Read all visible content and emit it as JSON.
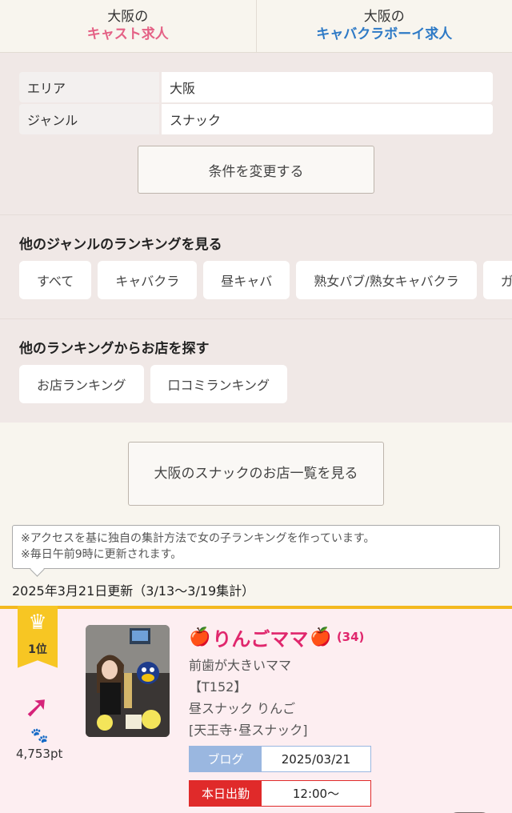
{
  "recruit_tabs": [
    {
      "sub": "大阪の",
      "main": "キャスト求人",
      "color": "#e46185"
    },
    {
      "sub": "大阪の",
      "main": "キャバクラボーイ求人",
      "color": "#2e7ac6"
    }
  ],
  "conditions": {
    "rows": [
      {
        "label": "エリア",
        "value": "大阪"
      },
      {
        "label": "ジャンル",
        "value": "スナック"
      }
    ],
    "change_button": "条件を変更する"
  },
  "genre_ranking": {
    "title": "他のジャンルのランキングを見る",
    "chips": [
      "すべて",
      "キャバクラ",
      "昼キャバ",
      "熟女パブ/熟女キャバクラ",
      "ガ"
    ]
  },
  "other_ranking": {
    "title": "他のランキングからお店を探す",
    "chips": [
      "お店ランキング",
      "口コミランキング"
    ]
  },
  "shop_list_button": "大阪のスナックのお店一覧を見る",
  "note": {
    "line1": "※アクセスを基に独自の集計方法で女の子ランキングを作っています。",
    "line2": "※毎日午前9時に更新されます。"
  },
  "updated": "2025年3月21日更新（3/13〜3/19集計）",
  "ranking_items": [
    {
      "rank": "1位",
      "trend_icon": "arrow-up-right-icon",
      "points": "4,753pt",
      "name": "りんごママ",
      "age": "(34)",
      "catch": "前歯が大きいママ",
      "size": "【T152】",
      "shop": "昼スナック りんご",
      "area": "[天王寺･昼スナック]",
      "blog_label": "ブログ",
      "blog_date": "2025/03/21",
      "work_label": "本日出勤",
      "work_time": "12:00〜"
    }
  ]
}
